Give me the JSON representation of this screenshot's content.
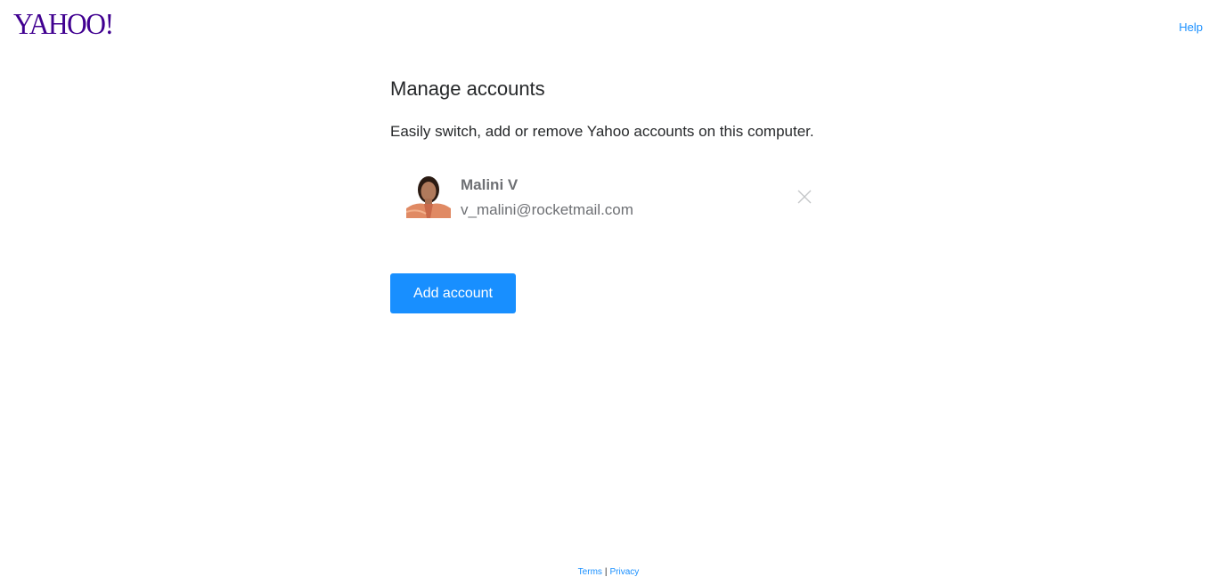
{
  "header": {
    "logo_text": "YAHOO!",
    "help_label": "Help"
  },
  "main": {
    "title": "Manage accounts",
    "subtitle": "Easily switch, add or remove Yahoo accounts on this computer.",
    "accounts": [
      {
        "name": "Malini V",
        "email": "v_malini@rocketmail.com",
        "avatar": "user-photo",
        "remove_icon": "close-icon"
      }
    ],
    "add_account_label": "Add account"
  },
  "footer": {
    "terms_label": "Terms",
    "separator": "|",
    "privacy_label": "Privacy"
  },
  "colors": {
    "brand": "#400090",
    "link": "#188fff",
    "button": "#188fff",
    "text": "#26282a",
    "muted_text": "#6e7074"
  }
}
